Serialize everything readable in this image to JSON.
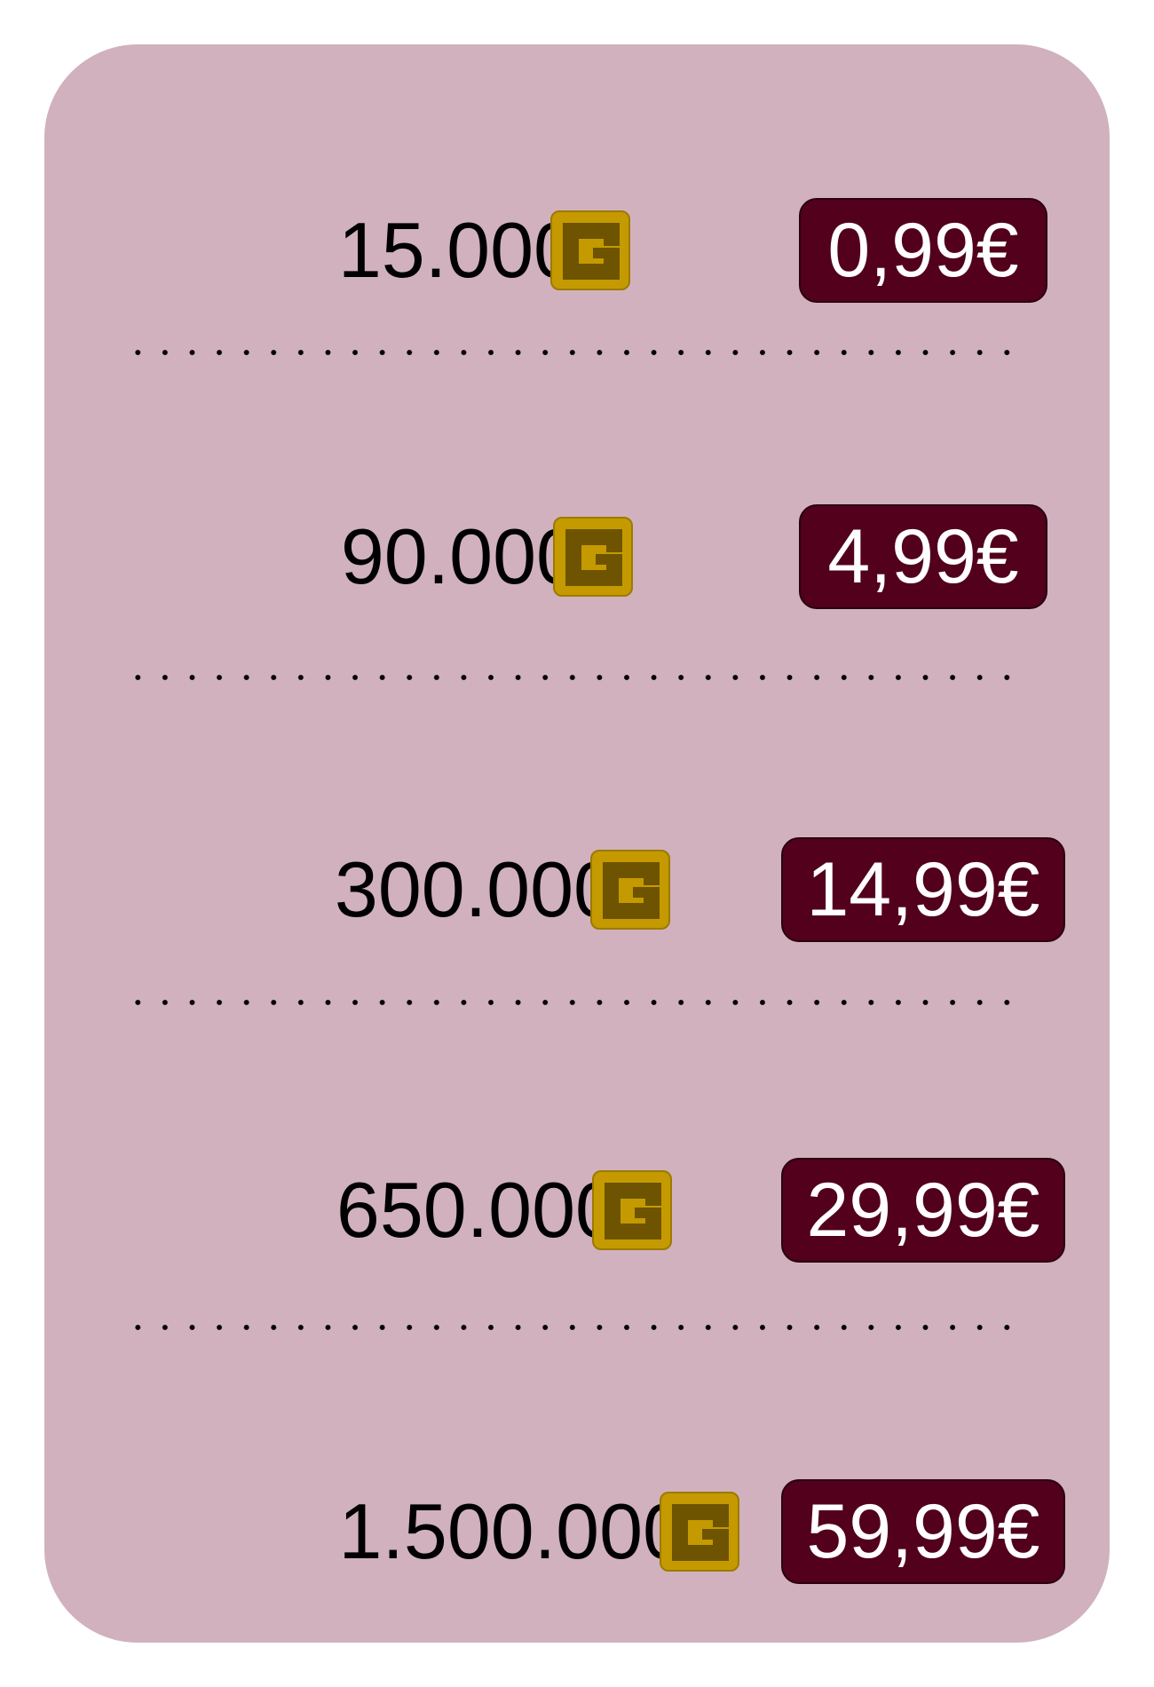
{
  "offers": [
    {
      "amount": "15.000",
      "currency_icon": "gold-g-coin-icon",
      "price": "0,99€"
    },
    {
      "amount": "90.000",
      "currency_icon": "gold-g-coin-icon",
      "price": "4,99€"
    },
    {
      "amount": "300.000",
      "currency_icon": "gold-g-coin-icon",
      "price": "14,99€"
    },
    {
      "amount": "650.000",
      "currency_icon": "gold-g-coin-icon",
      "price": "29,99€"
    },
    {
      "amount": "1.500.000",
      "currency_icon": "gold-g-coin-icon",
      "price": "59,99€"
    }
  ],
  "colors": {
    "panel_background": "#d1b1be",
    "price_button_background": "#52001b",
    "price_text": "#ffffff",
    "coin_gold": "#c49a00",
    "coin_inner": "#6e5400"
  }
}
